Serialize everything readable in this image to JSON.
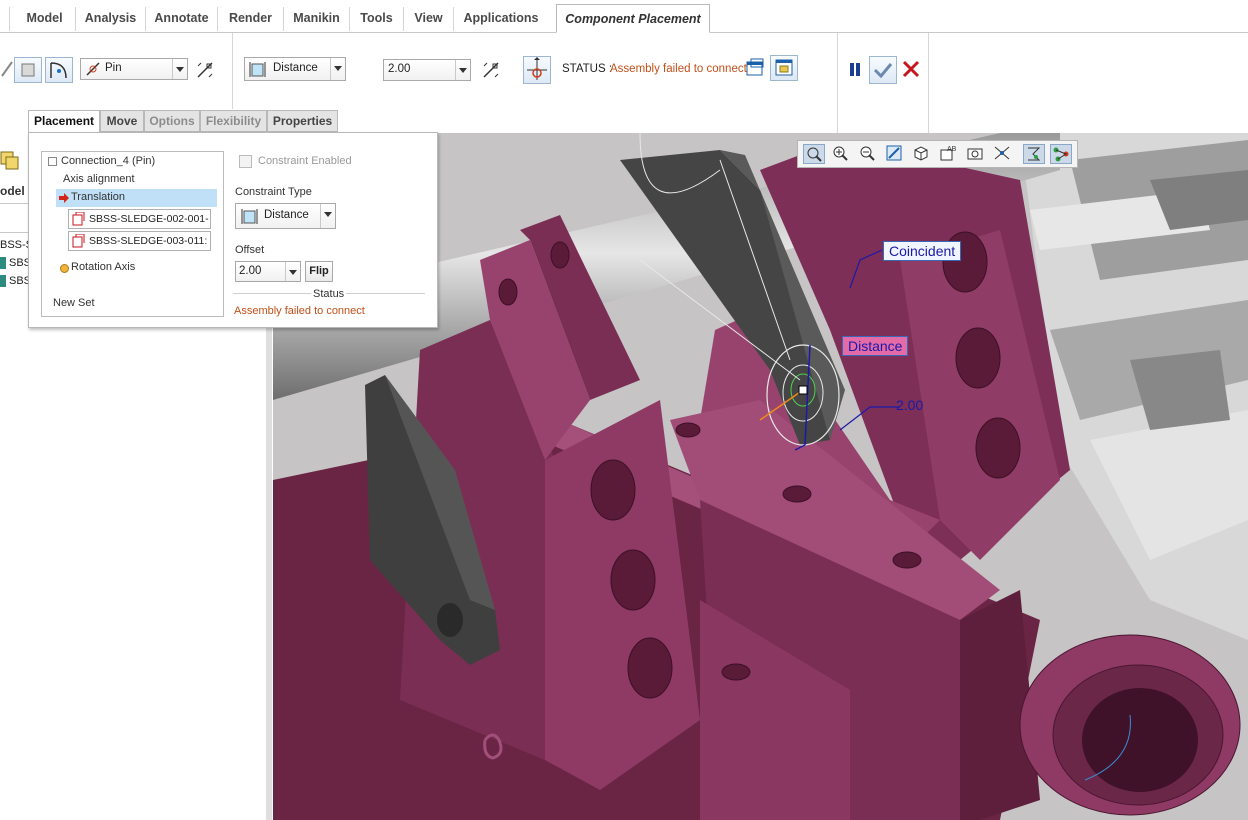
{
  "ribbon_tabs": [
    "Model",
    "Analysis",
    "Annotate",
    "Render",
    "Manikin",
    "Tools",
    "View",
    "Applications",
    "Component Placement"
  ],
  "ribbon": {
    "connection_type": "Pin",
    "constraint_type": "Distance",
    "offset_value": "2.00",
    "status_label": "STATUS :",
    "status_message": "Assembly failed to connect"
  },
  "subtabs": [
    "Placement",
    "Move",
    "Options",
    "Flexibility",
    "Properties"
  ],
  "placement_panel": {
    "connection": "Connection_4 (Pin)",
    "axis_alignment": "Axis alignment",
    "translation": "Translation",
    "refs": [
      "SBSS-SLEDGE-002-001-",
      "SBSS-SLEDGE-003-011:"
    ],
    "rotation_axis": "Rotation Axis",
    "new_set": "New Set",
    "constraint_enabled": "Constraint Enabled",
    "constraint_type_label": "Constraint Type",
    "constraint_type_value": "Distance",
    "offset_label": "Offset",
    "offset_value": "2.00",
    "flip": "Flip",
    "status_heading": "Status",
    "status_text": "Assembly failed to connect"
  },
  "model_tree": {
    "header": "odel T",
    "items": [
      "BSS-S",
      "SBS",
      "SBS"
    ]
  },
  "viewport_labels": {
    "coincident": "Coincident",
    "distance": "Distance",
    "dimension": "2.00"
  },
  "colors": {
    "status_text": "#c0501a",
    "part_magenta": "#8b3a62",
    "accent_blue": "#1a1aa8",
    "selection": "#bfe0f7"
  }
}
